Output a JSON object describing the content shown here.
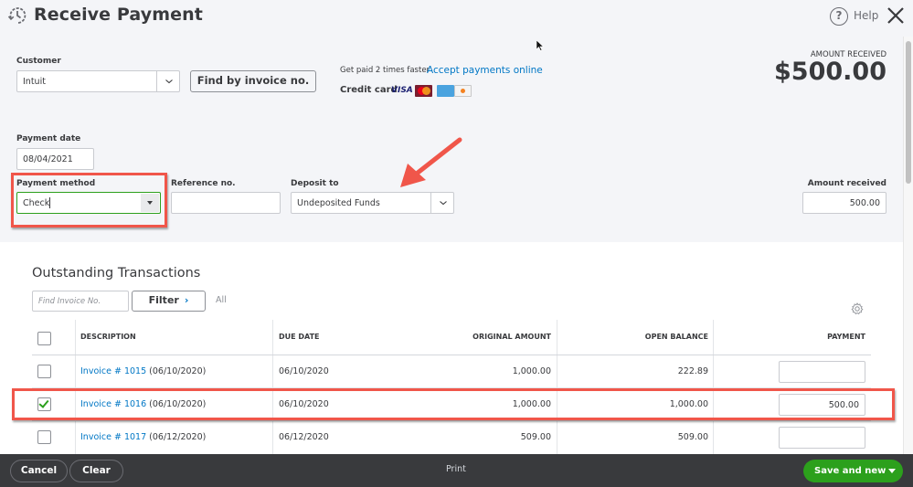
{
  "header": {
    "title": "Receive Payment",
    "help_label": "Help",
    "icons": {
      "title": "recurring-clock-icon",
      "help": "help-circle-icon",
      "close": "close-x-icon"
    },
    "help_glyph": "?"
  },
  "customer": {
    "label": "Customer",
    "value": "Intuit",
    "find_button": "Find by invoice no."
  },
  "promo": {
    "text": "Get paid 2 times faster",
    "link": "Accept payments online",
    "credit_card_label": "Credit card",
    "cards": [
      "VISA",
      "MasterCard",
      "American Express",
      "Discover"
    ]
  },
  "amount_received": {
    "label": "AMOUNT RECEIVED",
    "value": "$500.00"
  },
  "payment_date": {
    "label": "Payment date",
    "value": "08/04/2021"
  },
  "payment_method": {
    "label": "Payment method",
    "value": "Check"
  },
  "reference": {
    "label": "Reference no.",
    "value": ""
  },
  "deposit_to": {
    "label": "Deposit to",
    "value": "Undeposited Funds"
  },
  "amount_field": {
    "label": "Amount received",
    "value": "500.00"
  },
  "outstanding": {
    "title": "Outstanding Transactions",
    "search_placeholder": "Find Invoice No.",
    "filter_label": "Filter",
    "filter_chevron": "›",
    "filter_state": "All",
    "columns": [
      "DESCRIPTION",
      "DUE DATE",
      "ORIGINAL AMOUNT",
      "OPEN BALANCE",
      "PAYMENT"
    ],
    "rows": [
      {
        "checked": false,
        "invoice": "Invoice # 1015",
        "inv_date": "(06/10/2020)",
        "due_date": "06/10/2020",
        "original": "1,000.00",
        "open_balance": "222.89",
        "payment": ""
      },
      {
        "checked": true,
        "invoice": "Invoice # 1016",
        "inv_date": "(06/10/2020)",
        "due_date": "06/10/2020",
        "original": "1,000.00",
        "open_balance": "1,000.00",
        "payment": "500.00"
      },
      {
        "checked": false,
        "invoice": "Invoice # 1017",
        "inv_date": "(06/12/2020)",
        "due_date": "06/12/2020",
        "original": "509.00",
        "open_balance": "509.00",
        "payment": ""
      }
    ]
  },
  "footer": {
    "cancel": "Cancel",
    "clear": "Clear",
    "print": "Print",
    "save": "Save and new"
  },
  "colors": {
    "accent_green": "#2ca01c",
    "link_blue": "#0077c5",
    "annotation_red": "#f0564a",
    "footer_bg": "#393a3d"
  }
}
